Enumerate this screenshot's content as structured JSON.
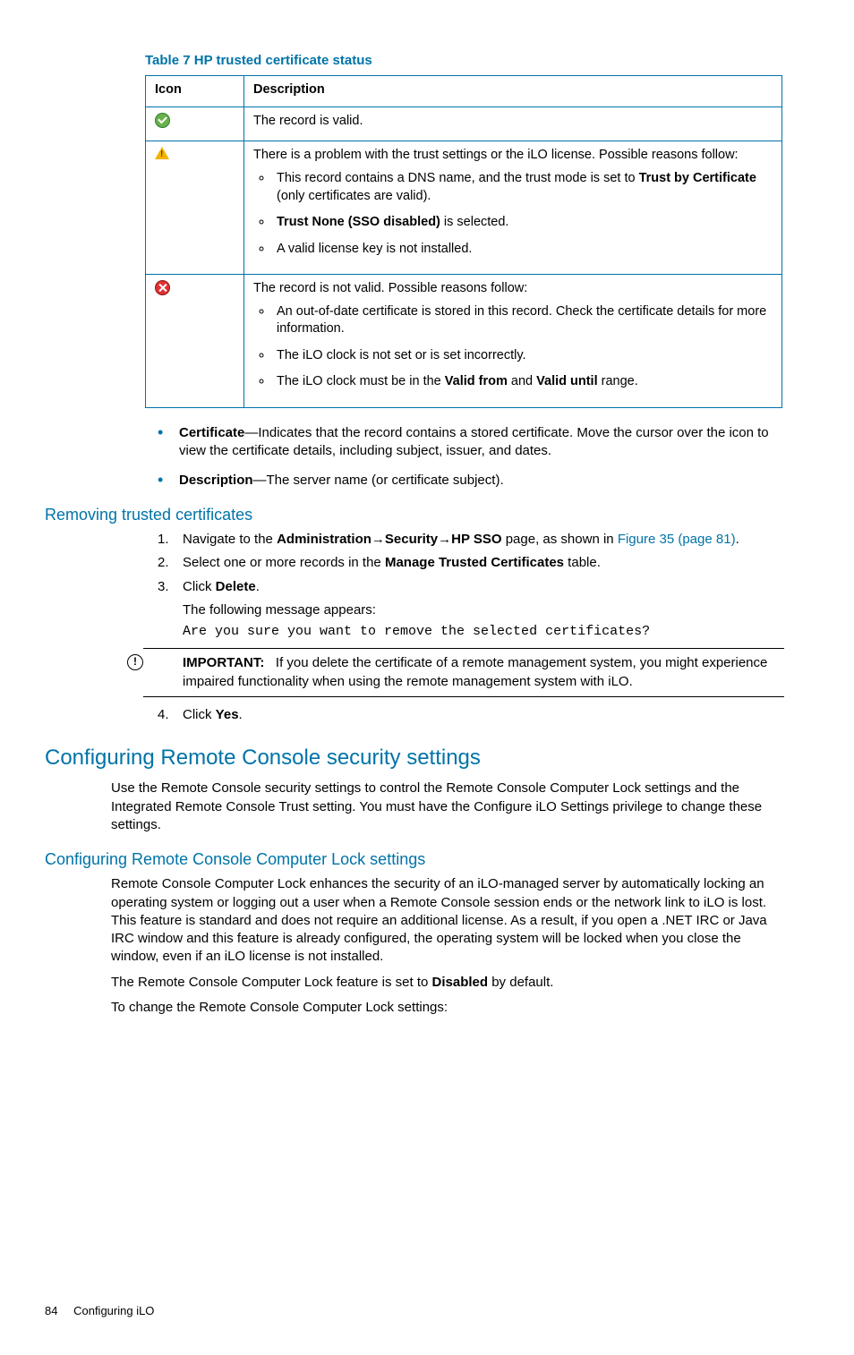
{
  "table": {
    "caption": "Table 7 HP trusted certificate status",
    "headers": {
      "icon": "Icon",
      "desc": "Description"
    },
    "rows": {
      "ok": {
        "desc": "The record is valid."
      },
      "warn": {
        "intro": "There is a problem with the trust settings or the iLO license. Possible reasons follow:",
        "li1a": "This record contains a DNS name, and the trust mode is set to ",
        "li1b": "Trust by Certificate",
        "li1c": " (only certificates are valid).",
        "li2a": "Trust None (SSO disabled)",
        "li2b": " is selected.",
        "li3": "A valid license key is not installed."
      },
      "err": {
        "intro": "The record is not valid. Possible reasons follow:",
        "li1": "An out-of-date certificate is stored in this record. Check the certificate details for more information.",
        "li2": "The iLO clock is not set or is set incorrectly.",
        "li3a": "The iLO clock must be in the ",
        "li3b": "Valid from",
        "li3c": " and ",
        "li3d": "Valid until",
        "li3e": " range."
      }
    }
  },
  "bullets": {
    "cert_label": "Certificate",
    "cert_text": "—Indicates that the record contains a stored certificate. Move the cursor over the icon to view the certificate details, including subject, issuer, and dates.",
    "desc_label": "Description",
    "desc_text": "—The server name (or certificate subject)."
  },
  "removing": {
    "heading": "Removing trusted certificates",
    "s1a": "Navigate to the ",
    "s1b": "Administration",
    "s1arrow": "→",
    "s1c": "Security",
    "s1d": "HP SSO",
    "s1e": " page, as shown in ",
    "s1link": "Figure 35 (page 81)",
    "s1f": ".",
    "s2a": "Select one or more records in the ",
    "s2b": "Manage Trusted Certificates",
    "s2c": " table.",
    "s3a": "Click ",
    "s3b": "Delete",
    "s3c": ".",
    "s3d": "The following message appears:",
    "s3code": "Are you sure you want to remove the selected certificates?",
    "s4a": "Click ",
    "s4b": "Yes",
    "s4c": "."
  },
  "important": {
    "label": "IMPORTANT:",
    "text": "If you delete the certificate of a remote management system, you might experience impaired functionality when using the remote management system with iLO."
  },
  "rc": {
    "h1": "Configuring Remote Console security settings",
    "p1": "Use the Remote Console security settings to control the Remote Console Computer Lock settings and the Integrated Remote Console Trust setting. You must have the Configure iLO Settings privilege to change these settings.",
    "h2": "Configuring Remote Console Computer Lock settings",
    "p2": "Remote Console Computer Lock enhances the security of an iLO-managed server by automatically locking an operating system or logging out a user when a Remote Console session ends or the network link to iLO is lost. This feature is standard and does not require an additional license. As a result, if you open a .NET IRC or Java IRC window and this feature is already configured, the operating system will be locked when you close the window, even if an iLO license is not installed.",
    "p3a": "The Remote Console Computer Lock feature is set to ",
    "p3b": "Disabled",
    "p3c": " by default.",
    "p4": "To change the Remote Console Computer Lock settings:"
  },
  "footer": {
    "page": "84",
    "section": "Configuring iLO"
  }
}
